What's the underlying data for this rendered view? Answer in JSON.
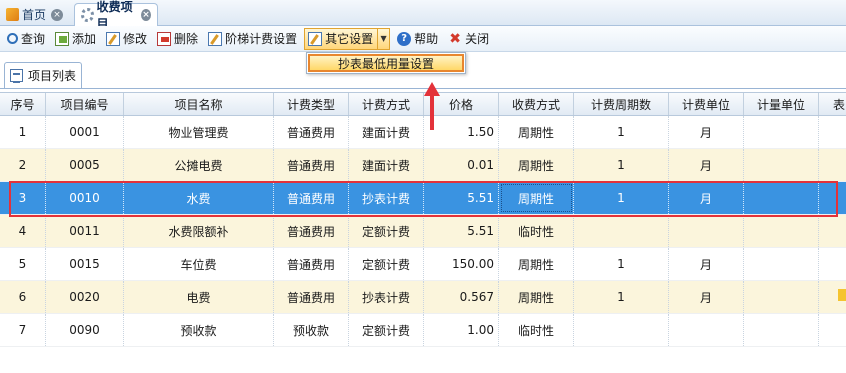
{
  "tabs": [
    {
      "label": "首页",
      "icon": "home-icon"
    },
    {
      "label": "收费项目",
      "icon": "gear-icon",
      "active": true
    }
  ],
  "toolbar": {
    "query": "查询",
    "add": "添加",
    "edit": "修改",
    "delete": "删除",
    "tier": "阶梯计费设置",
    "other": "其它设置",
    "help": "帮助",
    "close": "关闭"
  },
  "dropdown": {
    "items": [
      "抄表最低用量设置"
    ]
  },
  "panel": {
    "tab_label": "项目列表"
  },
  "grid": {
    "columns": [
      "序号",
      "项目编号",
      "项目名称",
      "计费类型",
      "计费方式",
      "价格",
      "收费方式",
      "计费周期数",
      "计费单位",
      "计量单位",
      "表"
    ],
    "rows": [
      [
        "1",
        "0001",
        "物业管理费",
        "普通费用",
        "建面计费",
        "1.50",
        "周期性",
        "1",
        "月",
        "",
        ""
      ],
      [
        "2",
        "0005",
        "公摊电费",
        "普通费用",
        "建面计费",
        "0.01",
        "周期性",
        "1",
        "月",
        "",
        ""
      ],
      [
        "3",
        "0010",
        "水费",
        "普通费用",
        "抄表计费",
        "5.51",
        "周期性",
        "1",
        "月",
        "",
        ""
      ],
      [
        "4",
        "0011",
        "水费限额补",
        "普通费用",
        "定额计费",
        "5.51",
        "临时性",
        "",
        "",
        "",
        ""
      ],
      [
        "5",
        "0015",
        "车位费",
        "普通费用",
        "定额计费",
        "150.00",
        "周期性",
        "1",
        "月",
        "",
        ""
      ],
      [
        "6",
        "0020",
        "电费",
        "普通费用",
        "抄表计费",
        "0.567",
        "周期性",
        "1",
        "月",
        "",
        ""
      ],
      [
        "7",
        "0090",
        "预收款",
        "预收款",
        "定额计费",
        "1.00",
        "临时性",
        "",
        "",
        "",
        ""
      ]
    ],
    "selected_row": 3
  },
  "colors": {
    "selected_row": "#3a93e1",
    "alt_row": "#fbf5dc",
    "annotation": "#e3323a",
    "menu_highlight": "#ffd868"
  }
}
